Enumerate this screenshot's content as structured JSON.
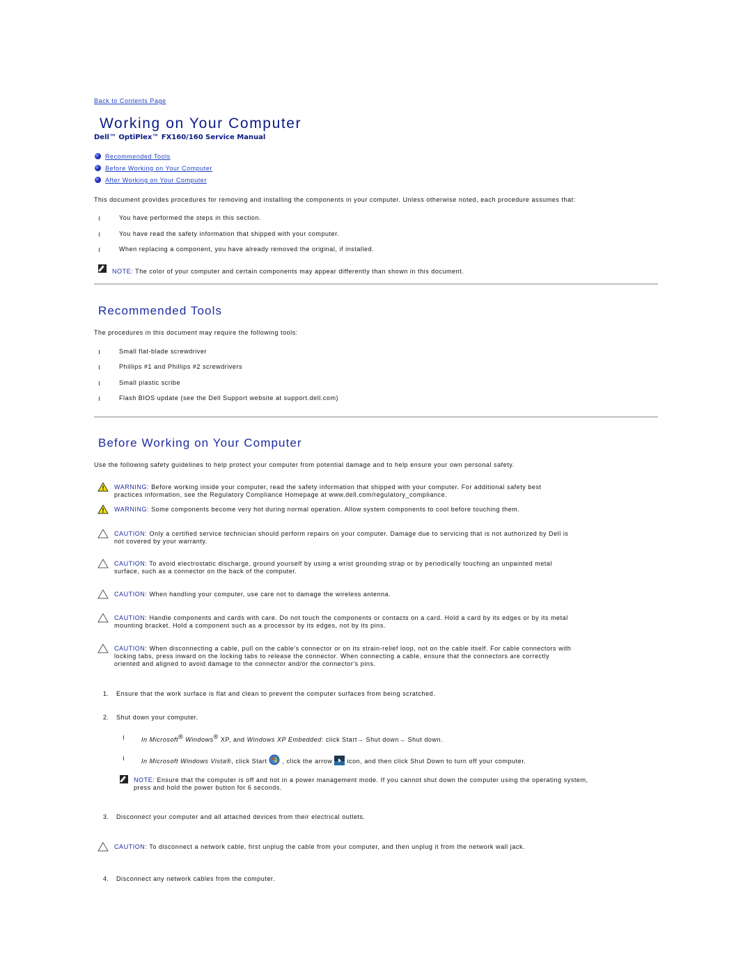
{
  "nav": {
    "back_link": "Back to Contents Page"
  },
  "header": {
    "title": "Working on Your Computer",
    "subtitle": "Dell™ OptiPlex™ FX160/160 Service Manual"
  },
  "toc": [
    {
      "label": "Recommended Tools",
      "icon": "bullet-dot-icon"
    },
    {
      "label": "Before Working on Your Computer",
      "icon": "bullet-dot-icon"
    },
    {
      "label": "After Working on Your Computer",
      "icon": "bullet-dot-icon"
    }
  ],
  "intro": {
    "text": "This document provides procedures for removing and installing the components in your computer. Unless otherwise noted, each procedure assumes that:",
    "assumptions": [
      "You have performed the steps in this section.",
      "You have read the safety information that shipped with your computer.",
      "When replacing a component, you have already removed the original, if installed."
    ],
    "note": {
      "icon": "note-pencil-icon",
      "label": "NOTE:",
      "text": " The color of your computer and certain components may appear differently than shown in this document."
    }
  },
  "tools_section": {
    "heading": "Recommended Tools",
    "intro": "The procedures in this document may require the following tools:",
    "items": [
      "Small flat-blade screwdriver",
      "Phillips #1 and Phillips #2 screwdrivers",
      "Small plastic scribe",
      "Flash BIOS update (see the Dell Support website at support.dell.com)"
    ]
  },
  "before_section": {
    "heading": "Before Working on Your Computer",
    "intro": "Use the following safety guidelines to help protect your computer from potential damage and to help ensure your own personal safety.",
    "notices": [
      {
        "type": "warning",
        "icon": "warning-triangle-icon",
        "label": "WARNING:",
        "line1": " Before working inside your computer, read the safety information that shipped with your computer. For additional safety best",
        "line2": "practices information, see the Regulatory Compliance Homepage at www.dell.com/regulatory_compliance."
      },
      {
        "type": "warning",
        "icon": "warning-triangle-icon",
        "label": "WARNING:",
        "line1": " Some components become very hot during normal operation. Allow system components to cool before touching them.",
        "line2": ""
      },
      {
        "type": "caution",
        "icon": "caution-triangle-icon",
        "label": "CAUTION:",
        "line1": " Only a certified service technician should perform repairs on your computer. Damage due to servicing that is not authorized by Dell is",
        "line2": "not covered by your warranty."
      },
      {
        "type": "caution",
        "icon": "caution-triangle-icon",
        "label": "CAUTION:",
        "line1": " To avoid electrostatic discharge, ground yourself by using a wrist grounding strap or by periodically touching an unpainted metal",
        "line2": "surface, such as a connector on the back of the computer."
      },
      {
        "type": "caution",
        "icon": "caution-triangle-icon",
        "label": "CAUTION:",
        "line1": " When handling your computer, use care not to damage the wireless antenna.",
        "line2": ""
      },
      {
        "type": "caution",
        "icon": "caution-triangle-icon",
        "label": "CAUTION:",
        "line1": " Handle components and cards with care. Do not touch the components or contacts on a card. Hold a card by its edges or by its metal",
        "line2": "mounting bracket. Hold a component such as a processor by its edges, not by its pins."
      },
      {
        "type": "caution",
        "icon": "caution-triangle-icon",
        "label": "CAUTION:",
        "line1": " When disconnecting a cable, pull on the cable's connector or on its strain-relief loop, not on the cable itself. For cable connectors with",
        "line2": "locking tabs, press inward on the locking tabs to release the connector. When connecting a cable, ensure that the connectors are correctly",
        "line3": "oriented and aligned to avoid damage to the connector and/or the connector's pins."
      }
    ],
    "steps": [
      {
        "num": "1.",
        "text": "Ensure that the work surface is flat and clean to prevent the computer surfaces from being scratched."
      },
      {
        "num": "2.",
        "text": "Shut down your computer."
      },
      {
        "num": "3.",
        "text": "Disconnect your computer and all attached devices from their electrical outlets."
      },
      {
        "num": "4.",
        "text": "Disconnect any network cables from the computer."
      }
    ],
    "shutdown": {
      "xp": {
        "italic1": "In Microsoft",
        "reg": "®",
        "italic2": " Windows",
        "text1": " XP, and ",
        "italic3": "Windows XP Embedded",
        "text2": ": click Start→ Shut down→ Shut down."
      },
      "vista": {
        "italic1": "In Microsoft Windows Vista",
        "text1": "®, click Start ",
        "start_icon": "windows-start-orb-icon",
        "text2": " , click the arrow ",
        "arrow_icon": "arrow-button-icon",
        "text3": " icon, and then click Shut Down to turn off your computer."
      },
      "note": {
        "icon": "note-pencil-icon",
        "label": "NOTE:",
        "line1": " Ensure that the computer is off and not in a power management mode. If you cannot shut down the computer using the operating system,",
        "line2": "press and hold the power button for 6 seconds."
      }
    },
    "network_caution": {
      "icon": "caution-triangle-icon",
      "label": "CAUTION:",
      "text": " To disconnect a network cable, first unplug the cable from your computer, and then unplug it from the network wall jack."
    }
  }
}
